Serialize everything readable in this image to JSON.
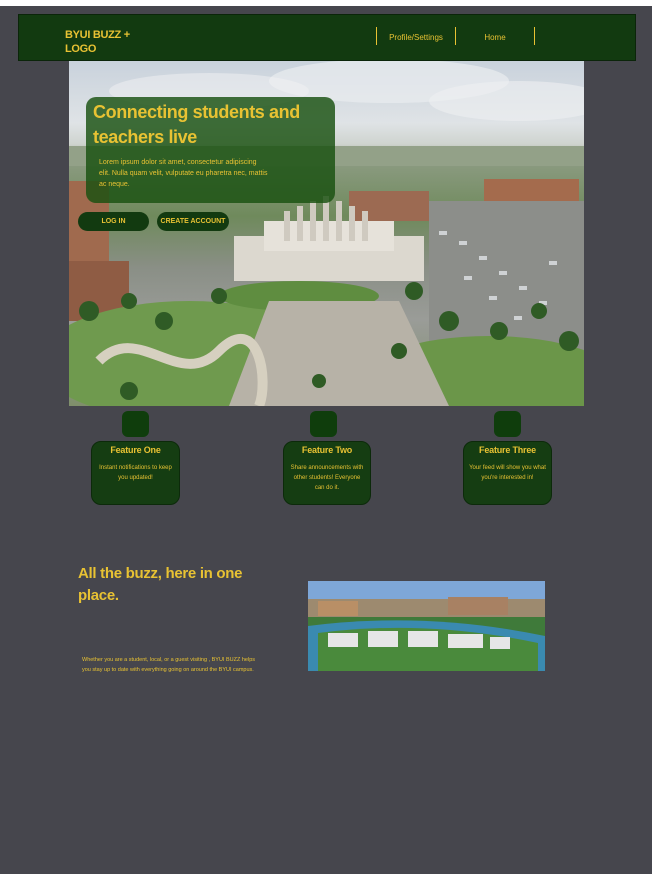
{
  "nav": {
    "logo": "BYUI BUZZ + LOGO",
    "links": [
      "Profile/Settings",
      "Home"
    ]
  },
  "hero": {
    "title": "Connecting students and teachers live",
    "text": "Lorem ipsum dolor sit amet, consectetur adipiscing elit. Nulla quam velit, vulputate eu pharetra nec, mattis ac neque.",
    "login_label": "LOG IN",
    "create_label": "CREATE ACCOUNT"
  },
  "features": [
    {
      "title": "Feature One",
      "desc": "Instant notifications to keep you updated!"
    },
    {
      "title": "Feature Two",
      "desc": "Share announcements with other students! Everyone can do it."
    },
    {
      "title": "Feature Three",
      "desc": "Your feed will show you what you're interested in!"
    }
  ],
  "buzz": {
    "title": "All the buzz, here in one place.",
    "text": "Whether you are a student, local, or a guest visiting , BYUI BUZZ helps you stay up to date with everything going on around the BYUI campus."
  },
  "colors": {
    "accent": "#e8c233",
    "primary": "#123a10",
    "background": "#46464d"
  }
}
